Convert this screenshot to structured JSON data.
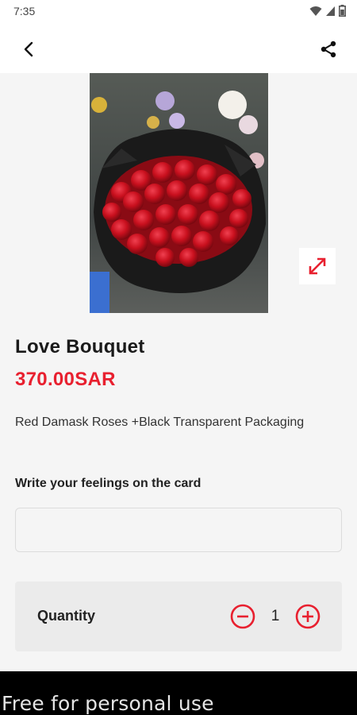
{
  "status_bar": {
    "time": "7:35",
    "icons": [
      "wifi-icon",
      "signal-icon",
      "battery-icon"
    ]
  },
  "app_bar": {
    "back_icon": "chevron-left-icon",
    "share_icon": "share-icon"
  },
  "product": {
    "image_subject": "Red roses bouquet in black packaging",
    "expand_icon": "expand-icon",
    "title": "Love Bouquet",
    "price": "370.00SAR",
    "description": "Red Damask Roses +Black Transparent Packaging"
  },
  "card_message": {
    "label": "Write your feelings on the card",
    "value": "",
    "placeholder": ""
  },
  "quantity": {
    "label": "Quantity",
    "value": "1",
    "minus_icon": "minus-circle-icon",
    "plus_icon": "plus-circle-icon"
  },
  "footer": {
    "watermark": "Free for personal use"
  },
  "colors": {
    "accent": "#e8202f",
    "background": "#f5f5f5",
    "quantity_panel": "#ebebeb"
  }
}
